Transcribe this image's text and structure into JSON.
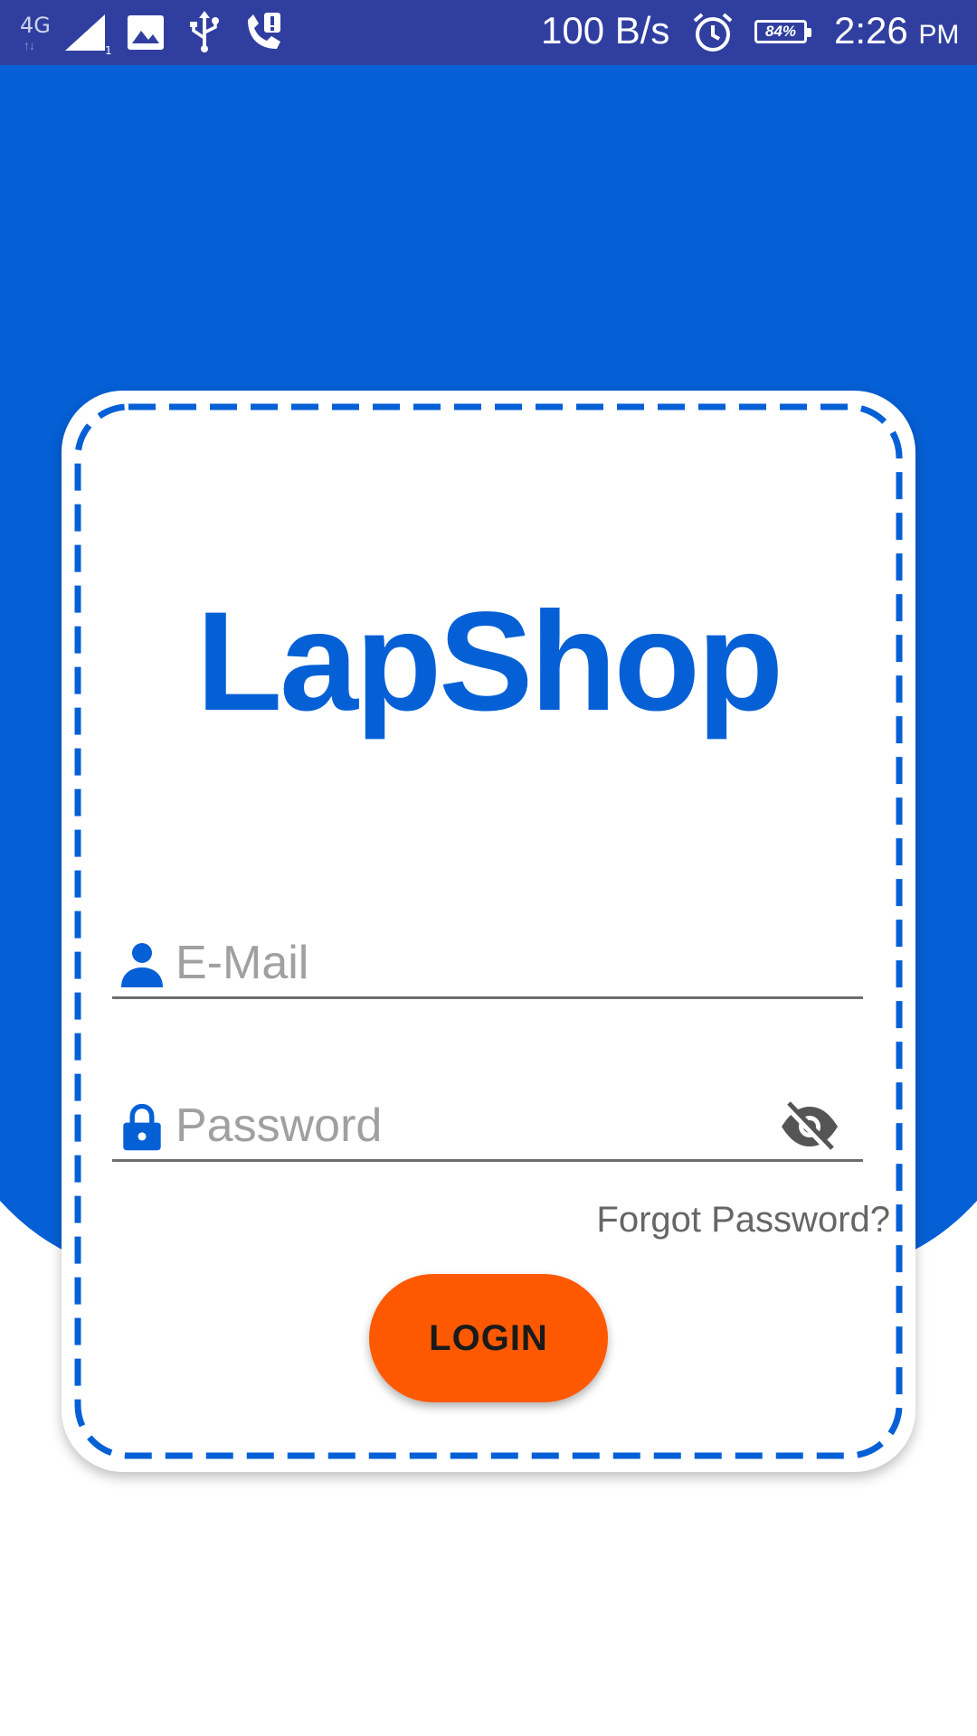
{
  "status_bar": {
    "network_type": "4G",
    "network_arrows": "↑↓",
    "signal_icon": "cell-signal-icon",
    "gallery_icon": "image-icon",
    "usb_icon": "usb-icon",
    "call_icon": "call-alert-icon",
    "data_speed": "100 B/s",
    "alarm_icon": "alarm-clock-icon",
    "battery_level": "84%",
    "time": "2:26",
    "ampm": "PM"
  },
  "login": {
    "title": "LapShop",
    "email": {
      "placeholder": "E-Mail",
      "value": "",
      "icon": "person-icon"
    },
    "password": {
      "placeholder": "Password",
      "value": "",
      "icon": "lock-icon",
      "toggle_icon": "eye-off-icon"
    },
    "forgot_password": "Forgot Password?",
    "login_button": "LOGIN"
  },
  "colors": {
    "status_bar": "#303f9f",
    "primary_blue": "#0560d6",
    "accent_orange": "#ff5900",
    "card_background": "#ffffff"
  }
}
